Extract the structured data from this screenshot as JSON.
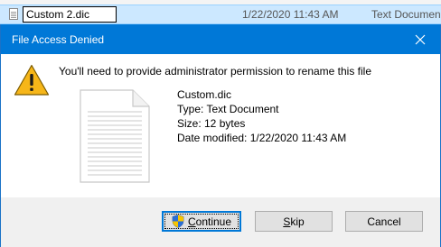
{
  "explorer": {
    "rename_value": "Custom 2.dic",
    "row_date": "1/22/2020 11:43 AM",
    "row_type": "Text Documen"
  },
  "dialog": {
    "title": "File Access Denied",
    "message": "You'll need to provide administrator permission to rename this file",
    "file": {
      "name": "Custom.dic",
      "type": "Type: Text Document",
      "size": "Size: 12 bytes",
      "modified": "Date modified: 1/22/2020 11:43 AM"
    },
    "buttons": {
      "continue_first": "C",
      "continue_rest": "ontinue",
      "skip_first": "S",
      "skip_rest": "kip",
      "cancel": "Cancel"
    }
  },
  "icons": {
    "warning": "warning-icon",
    "document": "document-icon",
    "shield": "uac-shield-icon",
    "close": "close-icon"
  },
  "colors": {
    "titlebar": "#0078d7",
    "selection": "#cce8ff",
    "dialog_bg": "#f0f0f0",
    "button_bg": "#e1e1e1",
    "warning_fill": "#f6b619"
  }
}
